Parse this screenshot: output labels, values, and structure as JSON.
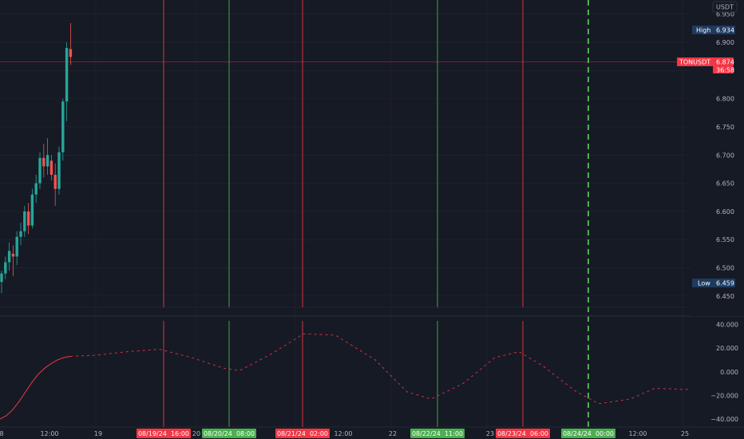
{
  "price_axis": {
    "currency": "USDT",
    "ticks": [
      "6.950",
      "6.900",
      "6.850",
      "6.800",
      "6.750",
      "6.700",
      "6.650",
      "6.600",
      "6.550",
      "6.500",
      "6.450"
    ],
    "high_label": "High",
    "high_value": "6.934",
    "low_label": "Low",
    "low_value": "6.459",
    "symbol": "TONUSDT",
    "current_price": "6.874",
    "countdown": "36:58"
  },
  "oscillator_axis": {
    "ticks": [
      "40.000",
      "20.000",
      "0.000",
      "−20.000",
      "−40.000"
    ]
  },
  "time_axis": {
    "labels": [
      "8",
      "12:00",
      "19",
      "20",
      "12:00",
      "22",
      "23",
      "12:00",
      "25"
    ],
    "markers": [
      {
        "label": "08/19/24  16:00",
        "color": "#f23645"
      },
      {
        "label": "08/20/24  08:00",
        "color": "#4caf50"
      },
      {
        "label": "08/21/24  02:00",
        "color": "#f23645"
      },
      {
        "label": "08/22/24  11:00",
        "color": "#4caf50"
      },
      {
        "label": "08/23/24  06:00",
        "color": "#f23645"
      },
      {
        "label": "08/24/24  00:00",
        "color": "#4caf50"
      }
    ]
  },
  "colors": {
    "background": "#161a25",
    "grid": "#232632",
    "up": "#26a69a",
    "down": "#ef5350",
    "red_line": "#f23645",
    "green_line": "#4caf50",
    "axis_tag": "#1e3a5f",
    "price_tag": "#f23645"
  },
  "chart_data": [
    {
      "type": "candlestick",
      "series": [
        {
          "name": "TONUSDT",
          "candles": [
            {
              "o": 6.475,
              "h": 6.495,
              "l": 6.455,
              "c": 6.49
            },
            {
              "o": 6.49,
              "h": 6.52,
              "l": 6.48,
              "c": 6.51
            },
            {
              "o": 6.51,
              "h": 6.545,
              "l": 6.495,
              "c": 6.53
            },
            {
              "o": 6.525,
              "h": 6.54,
              "l": 6.485,
              "c": 6.52
            },
            {
              "o": 6.52,
              "h": 6.565,
              "l": 6.505,
              "c": 6.555
            },
            {
              "o": 6.555,
              "h": 6.58,
              "l": 6.54,
              "c": 6.565
            },
            {
              "o": 6.565,
              "h": 6.61,
              "l": 6.555,
              "c": 6.6
            },
            {
              "o": 6.6,
              "h": 6.615,
              "l": 6.56,
              "c": 6.575
            },
            {
              "o": 6.575,
              "h": 6.64,
              "l": 6.57,
              "c": 6.63
            },
            {
              "o": 6.63,
              "h": 6.665,
              "l": 6.615,
              "c": 6.65
            },
            {
              "o": 6.65,
              "h": 6.705,
              "l": 6.64,
              "c": 6.695
            },
            {
              "o": 6.695,
              "h": 6.72,
              "l": 6.66,
              "c": 6.68
            },
            {
              "o": 6.68,
              "h": 6.73,
              "l": 6.665,
              "c": 6.7
            },
            {
              "o": 6.69,
              "h": 6.7,
              "l": 6.655,
              "c": 6.665
            },
            {
              "o": 6.665,
              "h": 6.685,
              "l": 6.61,
              "c": 6.64
            },
            {
              "o": 6.64,
              "h": 6.715,
              "l": 6.63,
              "c": 6.705
            },
            {
              "o": 6.705,
              "h": 6.8,
              "l": 6.69,
              "c": 6.795
            },
            {
              "o": 6.795,
              "h": 6.9,
              "l": 6.76,
              "c": 6.89
            },
            {
              "o": 6.888,
              "h": 6.934,
              "l": 6.86,
              "c": 6.874
            }
          ]
        }
      ],
      "ylim": [
        6.43,
        6.975
      ]
    },
    {
      "type": "line",
      "series": [
        {
          "style": "solid",
          "x": [
            0,
            8,
            16,
            24,
            32,
            40,
            48,
            56,
            64,
            72,
            80,
            88
          ],
          "values": [
            -40,
            -37,
            -32,
            -25,
            -17,
            -9,
            -2,
            3,
            7,
            10,
            12,
            13
          ]
        },
        {
          "style": "dashed",
          "x": [
            88,
            120,
            160,
            200,
            240,
            280,
            300,
            340,
            380,
            420,
            470,
            510,
            540,
            580,
            620,
            650,
            680,
            720,
            750,
            790,
            820,
            860,
            885
          ],
          "values": [
            13,
            14,
            17,
            19,
            12,
            3,
            1,
            15,
            32,
            31,
            10,
            -17,
            -23,
            -10,
            12,
            17,
            5,
            -16,
            -27,
            -23,
            -14,
            -15,
            -12
          ]
        }
      ],
      "ylim": [
        -46,
        43
      ]
    }
  ]
}
